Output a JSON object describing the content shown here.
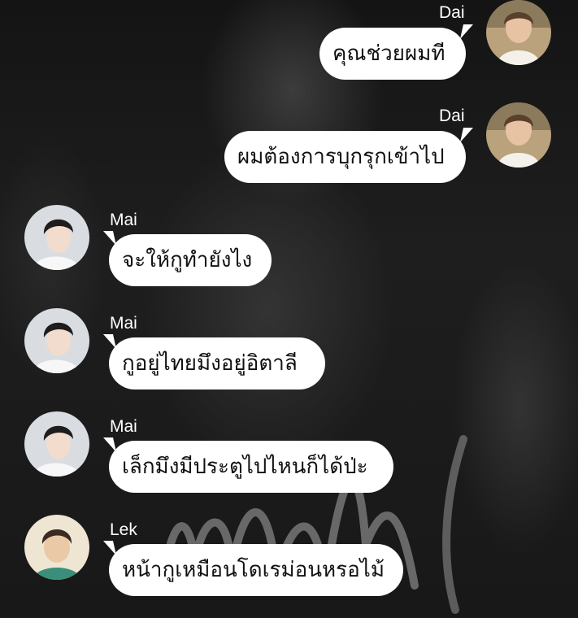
{
  "chat": {
    "messages": [
      {
        "sender": "Dai",
        "text": "คุณช่วยผมที",
        "side": "right",
        "avatar": "avatar-dai"
      },
      {
        "sender": "Dai",
        "text": "ผมต้องการบุกรุกเข้าไป",
        "side": "right",
        "avatar": "avatar-dai"
      },
      {
        "sender": "Mai",
        "text": "จะให้กูทำยังไง",
        "side": "left",
        "avatar": "avatar-mai"
      },
      {
        "sender": "Mai",
        "text": "กูอยู่ไทยมึงอยู่อิตาลี",
        "side": "left",
        "avatar": "avatar-mai"
      },
      {
        "sender": "Mai",
        "text": "เล็กมึงมีประตูไปไหนก็ได้ป่ะ",
        "side": "left",
        "avatar": "avatar-mai"
      },
      {
        "sender": "Lek",
        "text": "หน้ากูเหมือนโดเรม่อนหรอไม้",
        "side": "left",
        "avatar": "avatar-lek"
      }
    ]
  },
  "colors": {
    "bubble": "#ffffff",
    "bubble_text": "#111111",
    "name_text": "#ffffff",
    "background": "#1b1b1b"
  }
}
